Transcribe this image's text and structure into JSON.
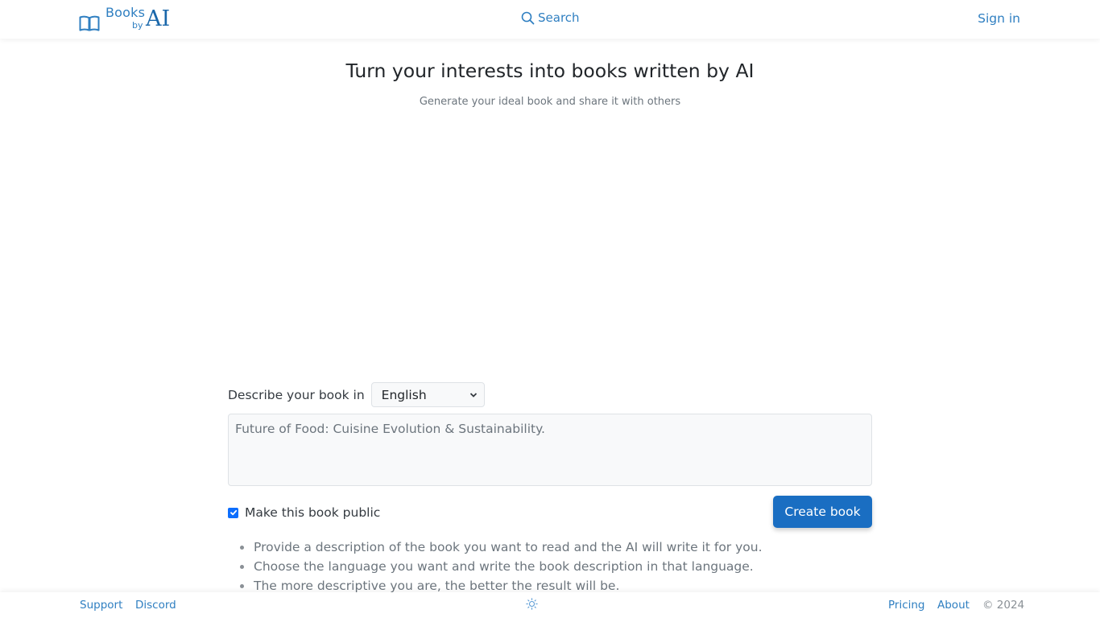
{
  "header": {
    "logo": {
      "books": "Books",
      "by": "by",
      "ai": "AI"
    },
    "search_label": "Search",
    "signin_label": "Sign in"
  },
  "hero": {
    "title": "Turn your interests into books written by AI",
    "subtitle": "Generate your ideal book and share it with others"
  },
  "form": {
    "language_label": "Describe your book in",
    "language_selected": "English",
    "description_placeholder": "Future of Food: Cuisine Evolution & Sustainability.",
    "description_value": "",
    "public_label": "Make this book public",
    "public_checked": true,
    "create_label": "Create book"
  },
  "tips": [
    "Provide a description of the book you want to read and the AI will write it for you.",
    "Choose the language you want and write the book description in that language.",
    "The more descriptive you are, the better the result will be."
  ],
  "footer": {
    "support": "Support",
    "discord": "Discord",
    "theme_icon": "sun-icon",
    "pricing": "Pricing",
    "about": "About",
    "copyright": "© 2024"
  },
  "colors": {
    "accent": "#2f7fc1",
    "button": "#1a6ec2",
    "checkbox": "#0d6efd",
    "muted_text": "#6c757d"
  }
}
